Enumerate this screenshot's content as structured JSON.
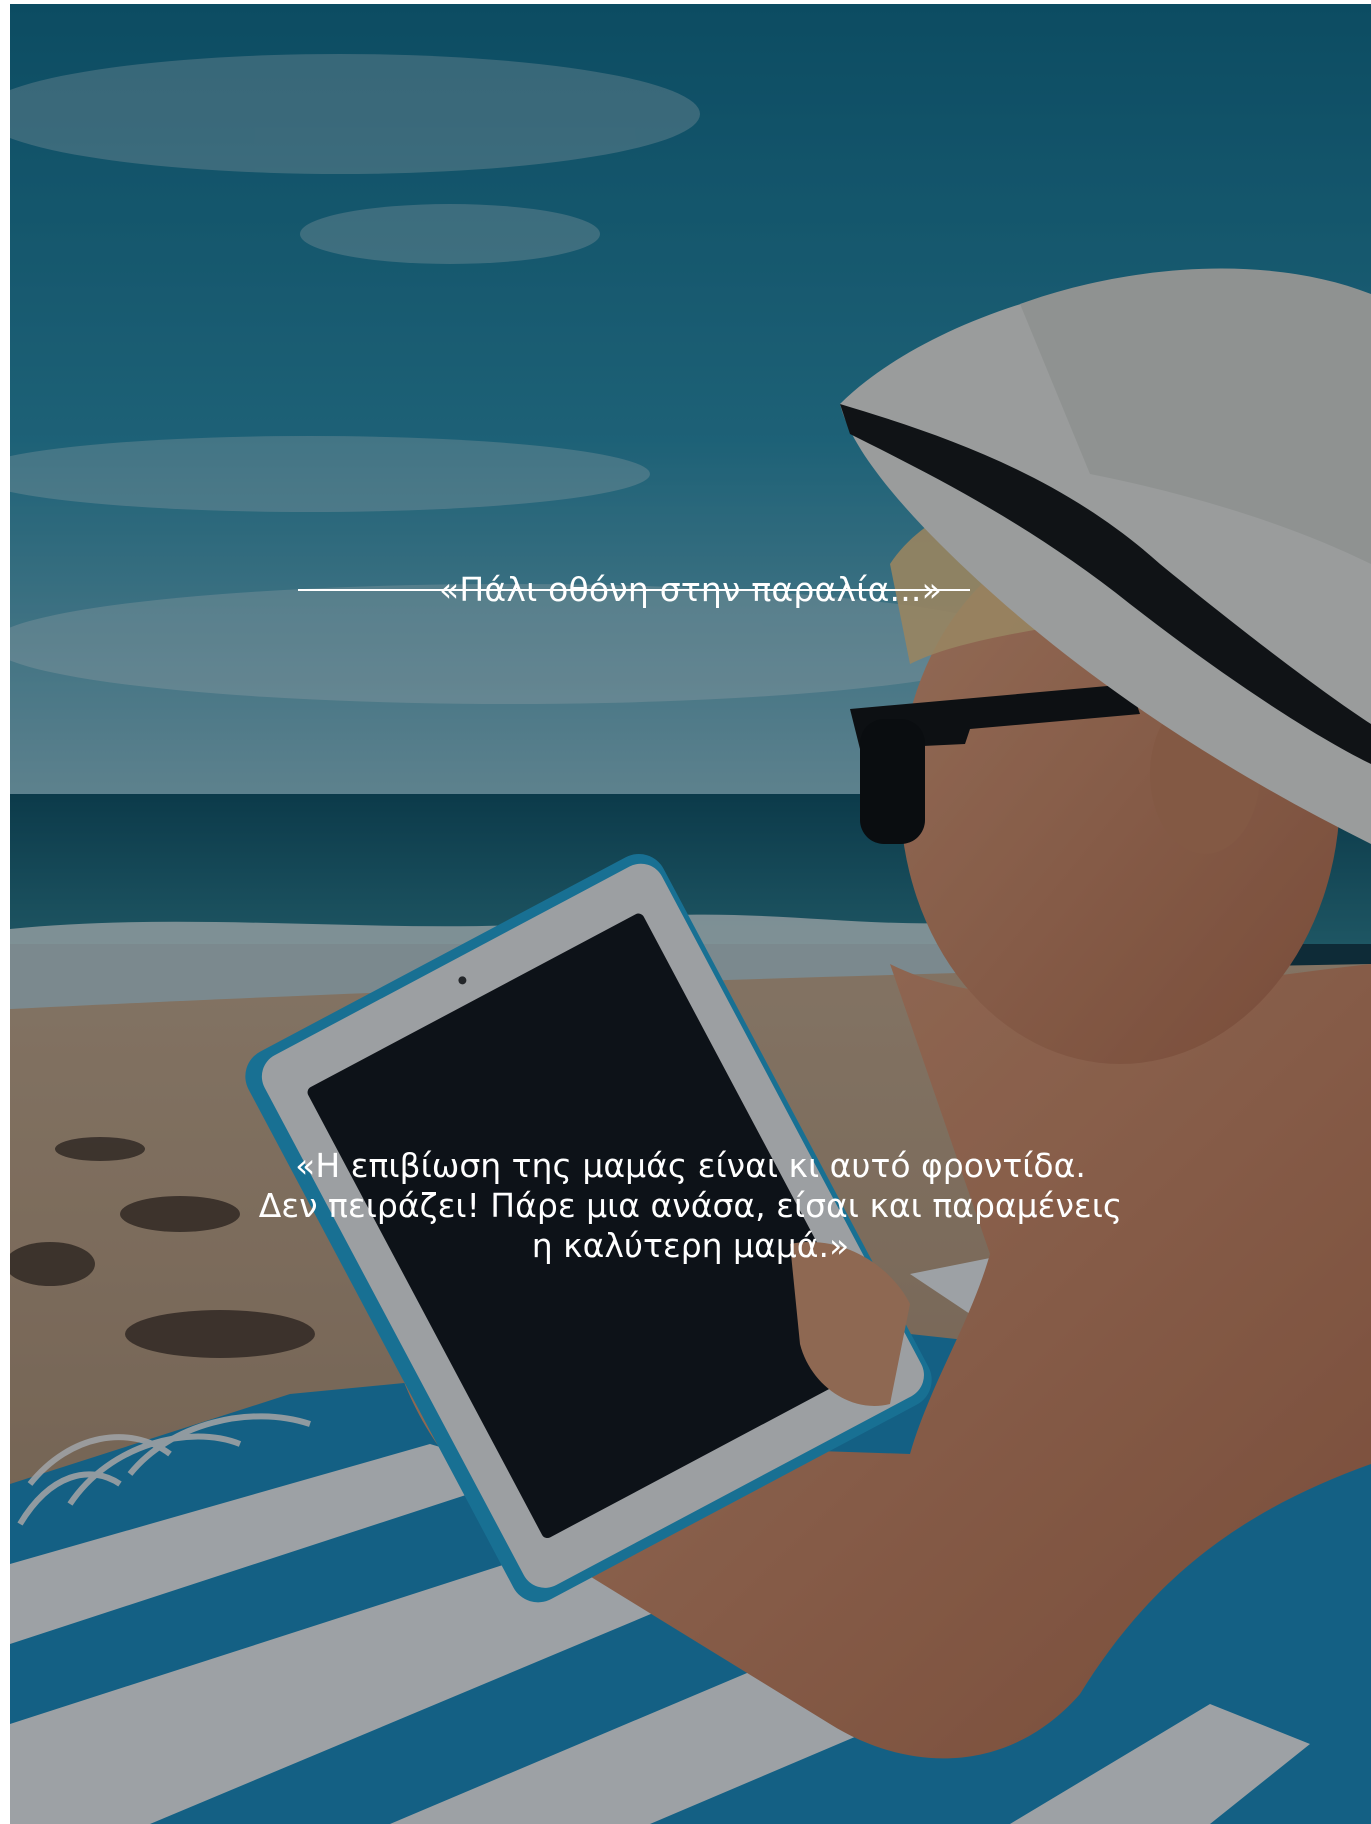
{
  "caption_top": "«Πάλι οθόνη στην παραλία...»",
  "caption_bottom": "«Η επιβίωση της μαμάς είναι κι αυτό φροντίδα.\nΔεν πειράζει! Πάρε μια ανάσα, είσαι και παραμένεις\nη καλύτερη μαμά.»",
  "colors": {
    "sky": "#1d7d98",
    "sea": "#145a6c",
    "sand": "#b99a7c",
    "towel_blue": "#1b8ec0",
    "text": "#ffffff"
  }
}
